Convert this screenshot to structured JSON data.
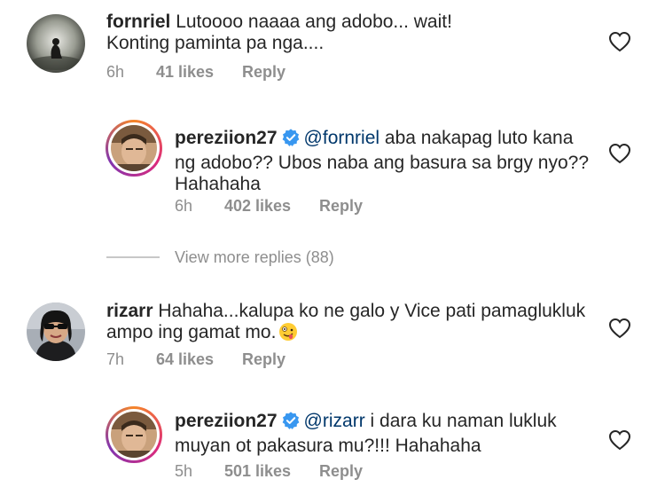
{
  "comments": [
    {
      "username": "fornriel",
      "text_line1": "Lutoooo naaaa ang adobo... wait!",
      "text_line2": "Konting paminta pa nga....",
      "time": "6h",
      "likes": "41 likes",
      "reply": "Reply"
    },
    {
      "username": "pereziion27",
      "mention": "@fornriel",
      "text_line1": " aba nakapag luto kana",
      "text_line2": "ng adobo?? Ubos naba ang basura sa brgy nyo??",
      "text_line3": "Hahahaha",
      "time": "6h",
      "likes": "402 likes",
      "reply": "Reply"
    },
    {
      "username": "rizarr",
      "text_line1": "Hahaha...kalupa ko ne galo y Vice pati pamaglukluk",
      "text_line2": "ampo ing gamat mo.",
      "time": "7h",
      "likes": "64 likes",
      "reply": "Reply"
    },
    {
      "username": "pereziion27",
      "mention": "@rizarr",
      "text_line1": " i dara ku naman lukluk",
      "text_line2": "muyan ot pakasura mu?!!! Hahahaha",
      "time": "5h",
      "likes": "501 likes",
      "reply": "Reply"
    }
  ],
  "view_more_replies": "View more replies (88)",
  "icons": {
    "heart": "heart-outline-icon",
    "verified": "verified-badge-icon",
    "emoji": "zany-face-emoji"
  },
  "colors": {
    "text": "#262626",
    "muted": "#8e8e8e",
    "mention": "#00376b",
    "verified": "#3897f0"
  }
}
